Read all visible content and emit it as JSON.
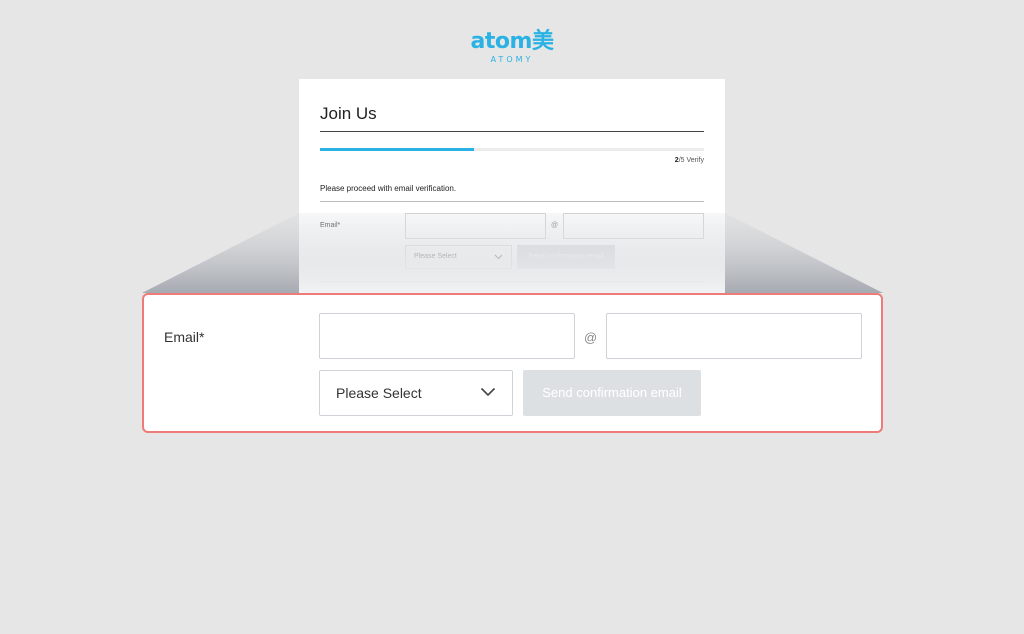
{
  "logo": {
    "wordmark": "atom美",
    "subtitle": "ATOMY"
  },
  "form": {
    "title": "Join Us",
    "progress": {
      "current_step": "2",
      "total": "/5",
      "step_name": "Verify",
      "fraction": 0.4
    },
    "instruction": "Please proceed with email verification.",
    "email_label": "Email*",
    "email_local_value": "",
    "email_domain_value": "",
    "at_symbol": "@",
    "domain_select": {
      "selected": "Please Select"
    },
    "send_button_label": "Send confirmation email"
  },
  "colors": {
    "brand": "#29b2e3",
    "highlight_border": "#ef7a7a",
    "disabled_button": "#dde0e3"
  }
}
